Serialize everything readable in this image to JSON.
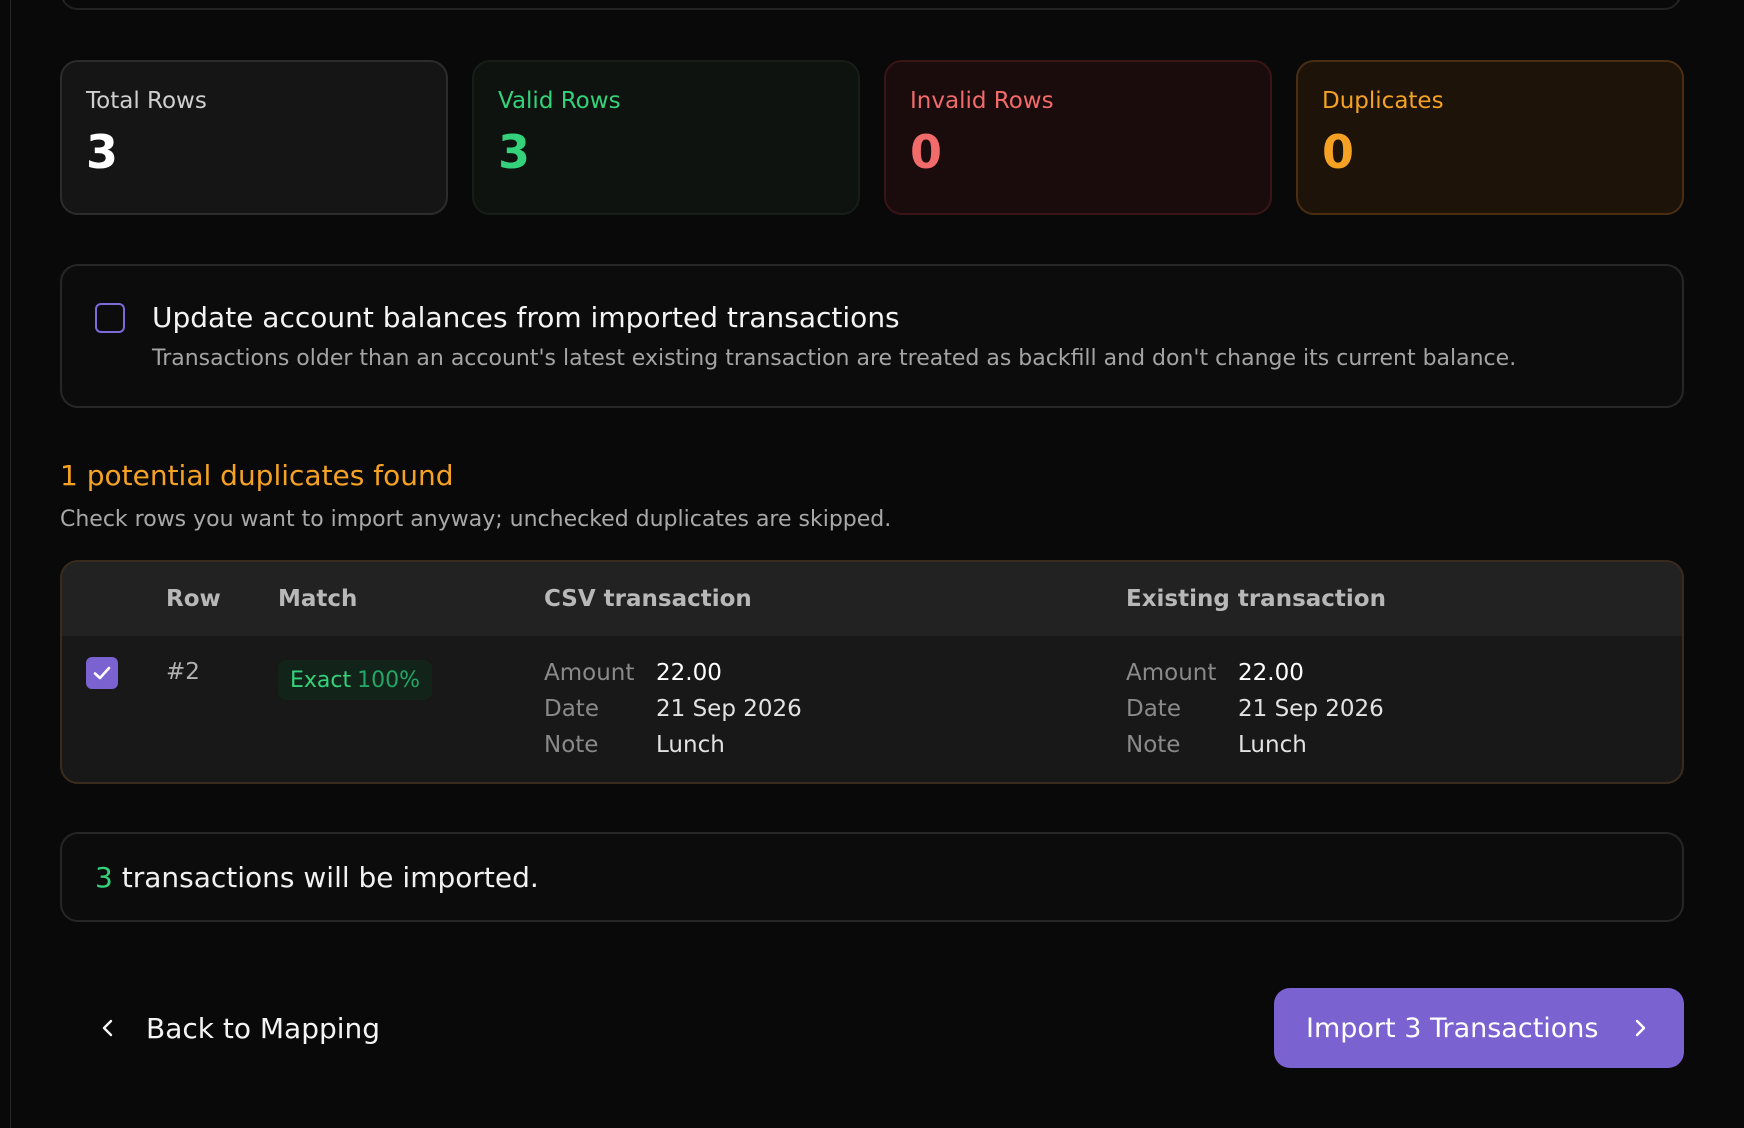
{
  "stats": {
    "total": {
      "label": "Total Rows",
      "value": "3"
    },
    "valid": {
      "label": "Valid Rows",
      "value": "3"
    },
    "invalid": {
      "label": "Invalid Rows",
      "value": "0"
    },
    "duplicates": {
      "label": "Duplicates",
      "value": "0"
    }
  },
  "option": {
    "checked": false,
    "title": "Update account balances from imported transactions",
    "description": "Transactions older than an account's latest existing transaction are treated as backfill and don't change its current balance."
  },
  "duplicates": {
    "heading": "1 potential duplicates found",
    "subtext": "Check rows you want to import anyway; unchecked duplicates are skipped.",
    "columns": {
      "row": "Row",
      "match": "Match",
      "csv": "CSV transaction",
      "existing": "Existing transaction"
    },
    "rows": [
      {
        "checked": true,
        "row": "#2",
        "match_type": "Exact",
        "match_score": "100%",
        "csv": {
          "amount_label": "Amount",
          "amount": "22.00",
          "date_label": "Date",
          "date": "21 Sep 2026",
          "note_label": "Note",
          "note": "Lunch"
        },
        "existing": {
          "amount_label": "Amount",
          "amount": "22.00",
          "date_label": "Date",
          "date": "21 Sep 2026",
          "note_label": "Note",
          "note": "Lunch"
        }
      }
    ]
  },
  "summary": {
    "count": "3",
    "text": " transactions will be imported."
  },
  "footer": {
    "back_label": "Back to Mapping",
    "import_label": "Import 3 Transactions"
  },
  "colors": {
    "accent": "#7a62d1",
    "valid": "#34d27a",
    "invalid": "#f26b6b",
    "duplicate": "#f5a224"
  },
  "icons": {
    "back": "chevron-left-icon",
    "import": "chevron-right-icon",
    "check": "check-icon"
  }
}
